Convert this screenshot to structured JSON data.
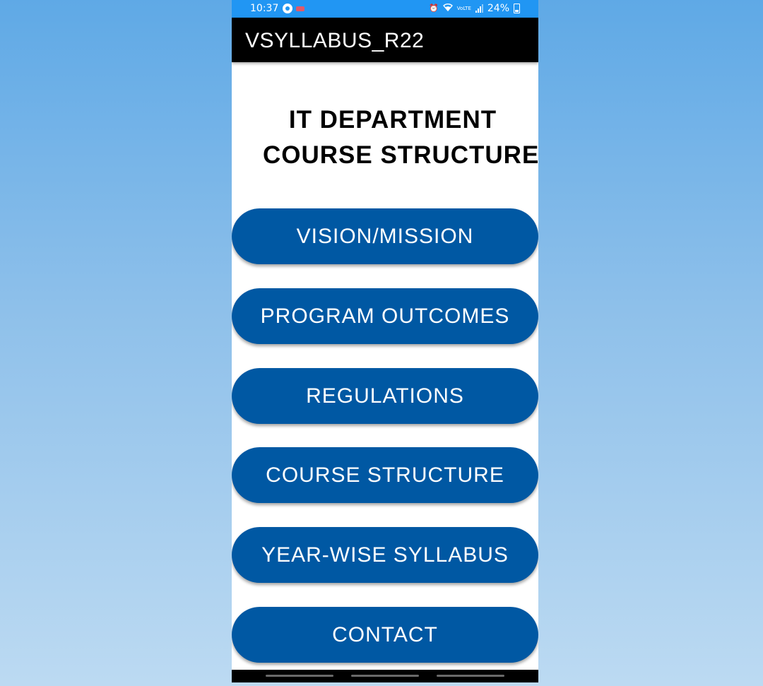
{
  "status_bar": {
    "time": "10:37",
    "battery": "24%",
    "network_label": "VoLTE"
  },
  "app_bar": {
    "title": "VSYLLABUS_R22"
  },
  "heading": {
    "line1": "IT DEPARTMENT",
    "line2": "COURSE STRUCTURE"
  },
  "menu": {
    "vision_mission": "VISION/MISSION",
    "program_outcomes": "PROGRAM OUTCOMES",
    "regulations": "REGULATIONS",
    "course_structure": "COURSE STRUCTURE",
    "year_wise_syllabus": "YEAR-WISE SYLLABUS",
    "contact": "CONTACT"
  },
  "colors": {
    "status_bar": "#2196f3",
    "app_bar": "#000000",
    "button": "#0058a3",
    "button_text": "#ffffff",
    "background_gradient_top": "#5fa9e6",
    "background_gradient_bottom": "#bcdaf2"
  },
  "icons": {
    "status_left": [
      "phone-call-icon",
      "message-icon"
    ],
    "status_right": [
      "alarm-icon",
      "wifi-icon",
      "volte-icon",
      "signal-icon",
      "battery-icon"
    ]
  }
}
